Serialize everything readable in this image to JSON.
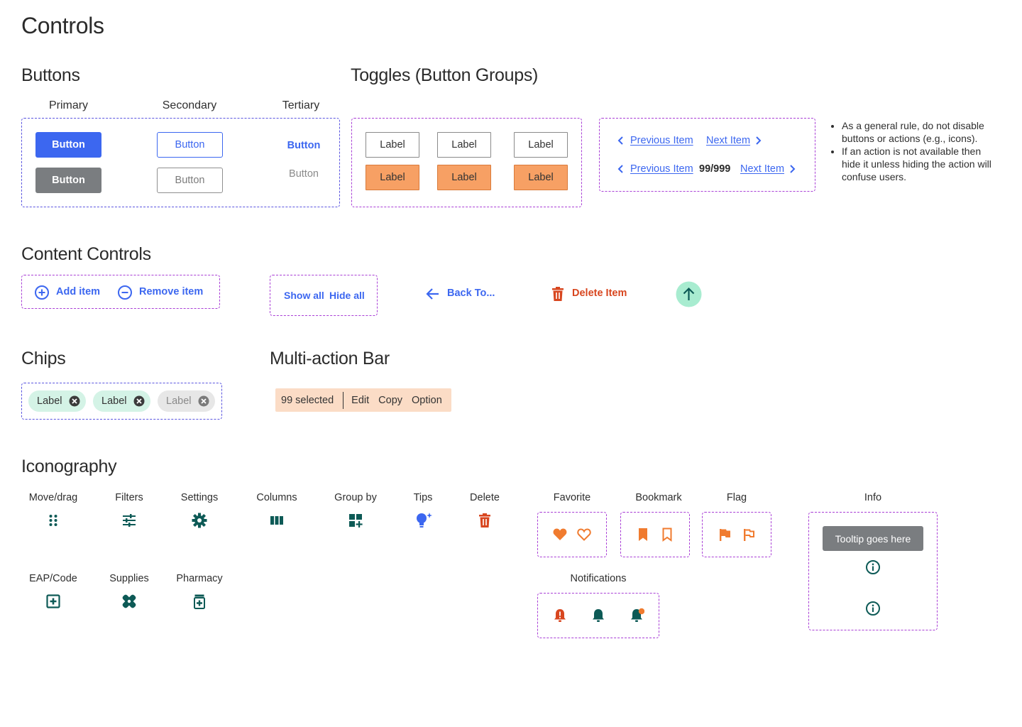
{
  "page": {
    "title": "Controls"
  },
  "buttons": {
    "title": "Buttons",
    "primary_head": "Primary",
    "secondary_head": "Secondary",
    "tertiary_head": "Tertiary",
    "primary_label": "Button",
    "primary_disabled_label": "Button",
    "secondary_label": "Button",
    "secondary_disabled_label": "Button",
    "tertiary_label": "Button",
    "tertiary_disabled_label": "Button"
  },
  "toggles": {
    "title": "Toggles (Button Groups)",
    "top": [
      "Label",
      "Label",
      "Label"
    ],
    "bottom": [
      "Label",
      "Label",
      "Label"
    ]
  },
  "pager": {
    "prev_label": "Previous Item",
    "next_label": "Next Item",
    "prev_label_2": "Previous Item",
    "count": "99/999",
    "next_label_2": "Next Item"
  },
  "guidance": [
    "As a general rule, do not disable buttons or actions (e.g., icons).",
    "If an action is not available then hide it unless hiding the action will confuse users."
  ],
  "content_controls": {
    "title": "Content Controls",
    "add": "Add item",
    "remove": "Remove item",
    "show_all": "Show all",
    "hide_all": "Hide all",
    "back": "Back To...",
    "delete": "Delete Item"
  },
  "chips": {
    "title": "Chips",
    "items": [
      "Label",
      "Label",
      "Label"
    ]
  },
  "multi_action": {
    "title": "Multi-action Bar",
    "selected": "99 selected",
    "actions": [
      "Edit",
      "Copy",
      "Option"
    ]
  },
  "iconography": {
    "title": "Iconography",
    "move": "Move/drag",
    "filters": "Filters",
    "settings": "Settings",
    "columns": "Columns",
    "group_by": "Group by",
    "tips": "Tips",
    "delete": "Delete",
    "favorite": "Favorite",
    "bookmark": "Bookmark",
    "flag": "Flag",
    "info": "Info",
    "eap": "EAP/Code",
    "supplies": "Supplies",
    "pharmacy": "Pharmacy",
    "notifications": "Notifications",
    "tooltip": "Tooltip goes here"
  },
  "colors": {
    "primary": "#3c67f0",
    "teal_icon": "#0d5a56",
    "orange": "#f07b2f",
    "danger": "#d8461f",
    "toggle_selected": "#f7a064",
    "chip": "#d4f3e6",
    "multi_action_bg": "#fbdcc6",
    "fab": "#a8ecd0"
  }
}
